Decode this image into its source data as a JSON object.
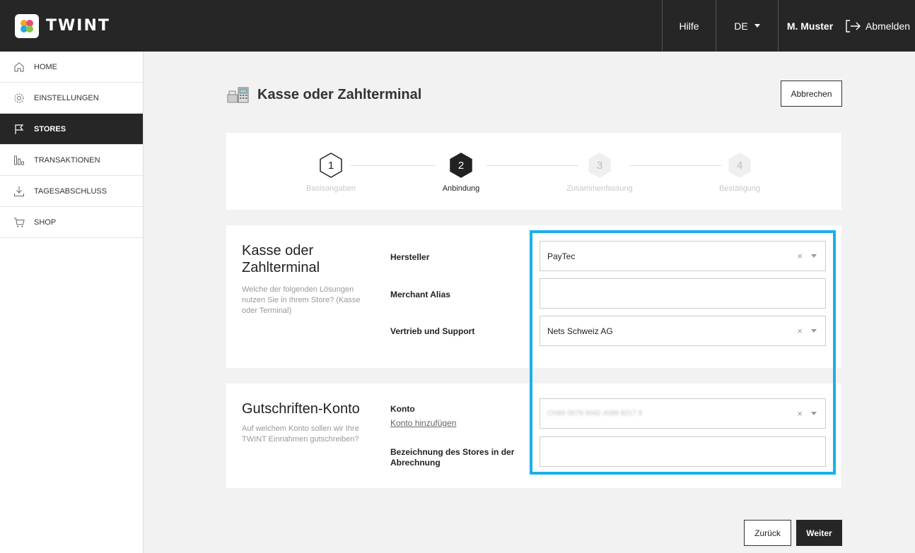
{
  "header": {
    "logo_text": "TWINT",
    "help": "Hilfe",
    "language": "DE",
    "user": "M. Muster",
    "logout": "Abmelden"
  },
  "sidebar": {
    "items": [
      {
        "label": "HOME",
        "icon": "home-icon"
      },
      {
        "label": "EINSTELLUNGEN",
        "icon": "gear-icon"
      },
      {
        "label": "STORES",
        "icon": "flag-icon",
        "active": true
      },
      {
        "label": "TRANSAKTIONEN",
        "icon": "bar-chart-icon"
      },
      {
        "label": "TAGESABSCHLUSS",
        "icon": "download-icon"
      },
      {
        "label": "SHOP",
        "icon": "cart-icon"
      }
    ]
  },
  "page": {
    "title": "Kasse oder Zahlterminal",
    "cancel": "Abbrechen"
  },
  "stepper": {
    "steps": [
      {
        "number": "1",
        "label": "Basisangaben",
        "state": "done"
      },
      {
        "number": "2",
        "label": "Anbindung",
        "state": "active"
      },
      {
        "number": "3",
        "label": "Zusammenfassung",
        "state": "pending"
      },
      {
        "number": "4",
        "label": "Bestätigung",
        "state": "pending"
      }
    ]
  },
  "terminal_section": {
    "title": "Kasse oder Zahlterminal",
    "description": "Welche der folgenden Lösungen nutzen Sie in Ihrem Store? (Kasse oder Terminal)",
    "manufacturer_label": "Hersteller",
    "manufacturer_value": "PayTec",
    "merchant_alias_label": "Merchant Alias",
    "merchant_alias_value": "",
    "support_label": "Vertrieb und Support",
    "support_value": "Nets Schweiz AG"
  },
  "account_section": {
    "title": "Gutschriften-Konto",
    "description": "Auf welchem Konto sollen wir Ihre TWINT Einnahmen gutschreiben?",
    "account_label": "Konto",
    "add_account_link": "Konto hinzufügen",
    "account_value": "CH66 0079 0042 4099 9217 9",
    "store_name_label": "Bezeichnung des Stores in der Abrechnung",
    "store_name_value": ""
  },
  "footer": {
    "back": "Zurück",
    "next": "Weiter"
  },
  "colors": {
    "dark": "#262626",
    "highlight": "#1ab0ea",
    "background": "#f2f2f2"
  },
  "clear_symbol": "×"
}
